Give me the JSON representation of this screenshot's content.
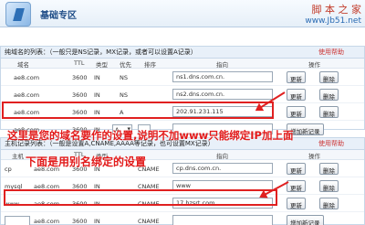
{
  "header": {
    "title": "基础专区"
  },
  "watermark": {
    "brand": "脚 本 之 家",
    "url": "www.Jb51.net"
  },
  "a_section": {
    "desc": "纯域名的列表：（一般只是NS记录，MX记录，或者可以设置A记录）",
    "help": "使用帮助",
    "columns": [
      "域名",
      "TTL",
      "类型",
      "优先",
      "排序",
      "指向",
      "操作"
    ],
    "rows": [
      {
        "domain": "ae8.com",
        "ttl": "3600",
        "in": "IN",
        "type": "NS",
        "point": "ns1.dns.com.cn.",
        "btn1": "更新",
        "btn2": "删除"
      },
      {
        "domain": "ae8.com",
        "ttl": "3600",
        "in": "IN",
        "type": "NS",
        "point": "ns2.dns.com.cn.",
        "btn1": "更新",
        "btn2": "删除"
      },
      {
        "domain": "ae8.com",
        "ttl": "3600",
        "in": "IN",
        "type": "A",
        "point": "202.91.231.115",
        "btn1": "更新",
        "btn2": "删除"
      }
    ],
    "new_row": {
      "domain": "ae8.com",
      "ttl": "3600",
      "in": "IN",
      "type_select": "A",
      "add_button": "增加新记录"
    }
  },
  "host_section": {
    "desc": "主机记录列表：（一般是设置A,CNAME,AAAA等记录，也可设置MX记录）",
    "help": "使用帮助",
    "columns": [
      "主机",
      "TTL",
      "类型",
      "指向",
      "操作"
    ],
    "rows": [
      {
        "host": "cp",
        "domain": "ae8.com",
        "ttl": "3600",
        "in": "IN",
        "type": "CNAME",
        "point": "cp.dns.com.cn.",
        "btn1": "更新",
        "btn2": "删除"
      },
      {
        "host": "mysql",
        "domain": "ae8.com",
        "ttl": "3600",
        "in": "IN",
        "type": "CNAME",
        "point": "www",
        "btn1": "更新",
        "btn2": "删除"
      },
      {
        "host": "www",
        "domain": "ae8.com",
        "ttl": "3600",
        "in": "IN",
        "type": "CNAME",
        "point": "17.hzsrt.com.",
        "btn1": "更新",
        "btn2": "删除"
      }
    ],
    "new_row": {
      "domain": "ae8.com",
      "ttl": "3600",
      "in": "IN",
      "type": "CNAME",
      "add_button": "增加新记录"
    }
  },
  "annotations": {
    "line1": "这里是您的域名要作的设置,说明不加www只能绑定IP加上面",
    "line2": "下面是用别名绑定的设置"
  },
  "colors": {
    "annotation": "#e21a1a",
    "header_blue": "#1e4c87"
  }
}
